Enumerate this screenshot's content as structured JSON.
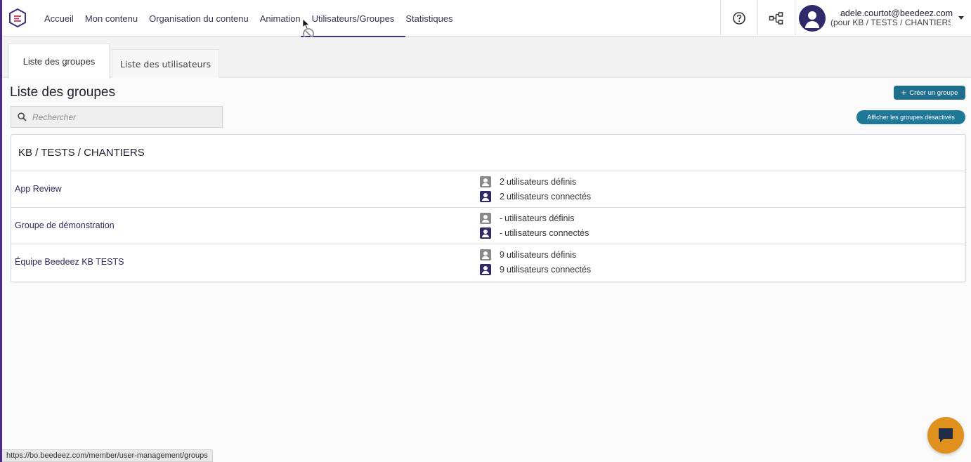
{
  "nav": {
    "items": [
      {
        "label": "Accueil",
        "active": false
      },
      {
        "label": "Mon contenu",
        "active": false
      },
      {
        "label": "Organisation du contenu",
        "active": false
      },
      {
        "label": "Animation",
        "active": false
      },
      {
        "label": "Utilisateurs/Groupes",
        "active": true
      },
      {
        "label": "Statistiques",
        "active": false
      }
    ]
  },
  "user": {
    "email": "adele.courtot@beedeez.com",
    "org": "(pour KB / TESTS / CHANTIERS)"
  },
  "tabs": {
    "groups": "Liste des groupes",
    "users": "Liste des utilisateurs"
  },
  "page": {
    "title": "Liste des groupes",
    "create_button": "Créer un groupe",
    "disabled_groups_button": "Afficher les groupes désactivés",
    "search_placeholder": "Rechercher"
  },
  "card": {
    "title": "KB / TESTS / CHANTIERS",
    "groups": [
      {
        "name": "App Review",
        "defined": "2",
        "connected": "2"
      },
      {
        "name": "Groupe de démonstration",
        "defined": "-",
        "connected": "-"
      },
      {
        "name": "Équipe Beedeez KB TESTS",
        "defined": "9",
        "connected": "9"
      }
    ],
    "defined_label": "utilisateurs définis",
    "connected_label": "utilisateurs connectés"
  },
  "statusbar": {
    "url": "https://bo.beedeez.com/member/user-management/groups"
  },
  "colors": {
    "brand_navy": "#2f2a6b",
    "teal_button": "#1e7898",
    "chat_orange": "#e0901d"
  },
  "icons": {
    "help": "help-circle-icon",
    "share": "share-nodes-icon",
    "search": "search-icon",
    "chat": "chat-icon",
    "user_grey": "user-card-icon",
    "user_navy": "user-card-icon"
  }
}
